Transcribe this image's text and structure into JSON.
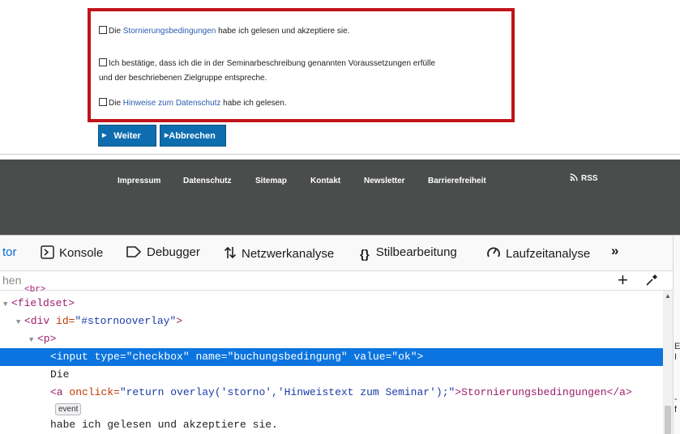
{
  "form": {
    "checkbox1": {
      "prefix": "Die ",
      "link": "Stornierungsbedingungen",
      "suffix": " habe ich gelesen und akzeptiere sie."
    },
    "checkbox2": {
      "line1": "Ich bestätige, dass ich die in der Seminarbeschreibung genannten Voraussetzungen erfülle",
      "line2": "und der beschriebenen Zielgruppe entspreche."
    },
    "checkbox3": {
      "prefix": "Die ",
      "link": "Hinweise zum Datenschutz",
      "suffix": " habe ich gelesen."
    },
    "buttons": {
      "next": "Weiter",
      "cancel": "Abbrechen"
    }
  },
  "footer": {
    "links": [
      "Impressum",
      "Datenschutz",
      "Sitemap",
      "Kontakt",
      "Newsletter",
      "Barrierefreiheit"
    ],
    "rss": "RSS"
  },
  "devtools": {
    "tabs": {
      "inspector_partial": "tor",
      "console": "Konsole",
      "debugger": "Debugger",
      "network": "Netzwerkanalyse",
      "style": "Stilbearbeitung",
      "performance": "Laufzeitanalyse",
      "more": "»"
    },
    "search_placeholder": "hen",
    "add_label": "+",
    "code": {
      "l0": "<br>",
      "l1_tag": "<fieldset>",
      "l2_open": "<div ",
      "l2_attr": "id=",
      "l2_val": "\"#stornooverlay\"",
      "l2_close": ">",
      "l3": "<p>",
      "l4_open": "<input ",
      "l4_a1": "type=",
      "l4_v1": "\"checkbox\"",
      "l4_a2": " name=",
      "l4_v2": "\"buchungsbedingung\"",
      "l4_a3": " value=",
      "l4_v3": "\"ok\"",
      "l4_close": ">",
      "l5": "Die",
      "l6_open": "<a ",
      "l6_attr": "onclick=",
      "l6_val": "\"return overlay('storno','Hinweistext zum Seminar');\"",
      "l6_mid": ">Stornierungsbedingungen</a>",
      "l7_badge": "event",
      "l8": "habe ich gelesen und akzeptiere sie."
    },
    "side_letters": [
      "E",
      "I",
      "-",
      "f"
    ]
  }
}
